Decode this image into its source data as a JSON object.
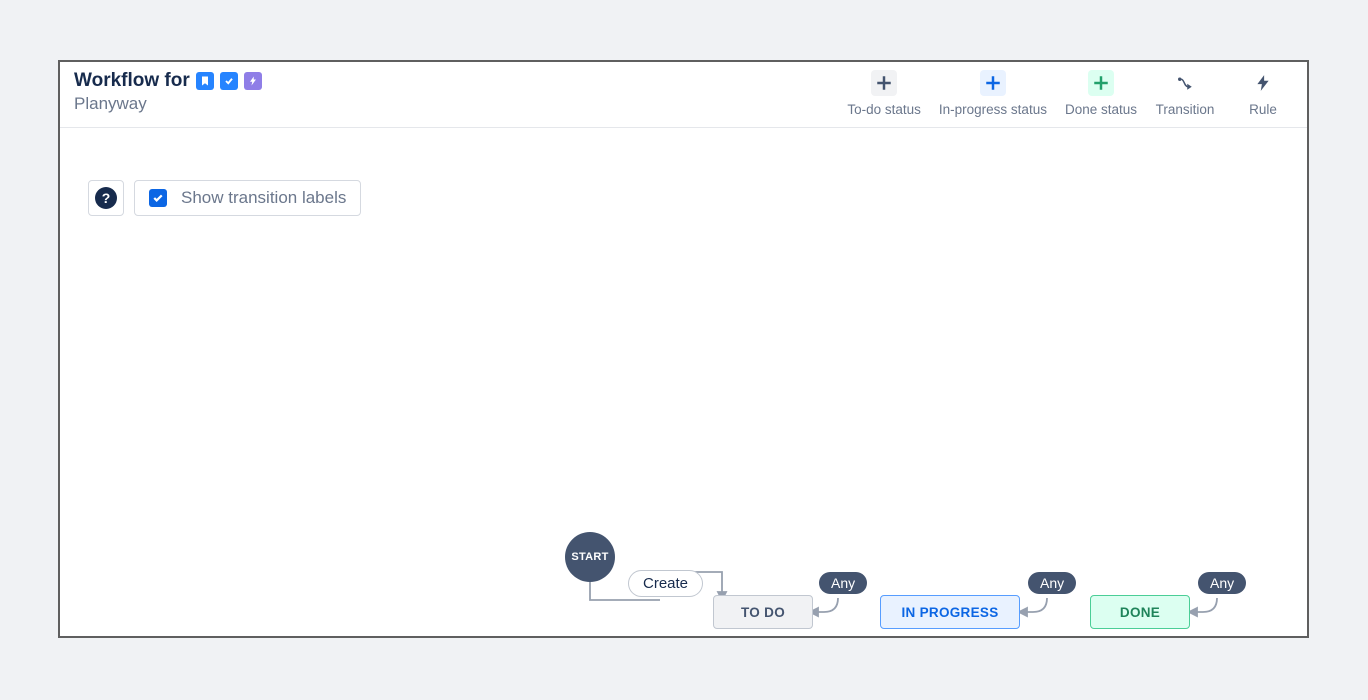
{
  "header": {
    "title_prefix": "Workflow for",
    "subtitle": "Planyway",
    "type_badges": [
      "story",
      "task",
      "epic"
    ]
  },
  "toolbar": {
    "todo_label": "To-do status",
    "inprogress_label": "In-progress status",
    "done_label": "Done status",
    "transition_label": "Transition",
    "rule_label": "Rule"
  },
  "controls": {
    "help_tooltip": "?",
    "show_transition_labels": "Show transition labels",
    "show_transition_labels_checked": true
  },
  "diagram": {
    "start_label": "START",
    "create_label": "Create",
    "statuses": {
      "todo": "TO DO",
      "inprogress": "IN PROGRESS",
      "done": "DONE"
    },
    "any_label": "Any"
  }
}
